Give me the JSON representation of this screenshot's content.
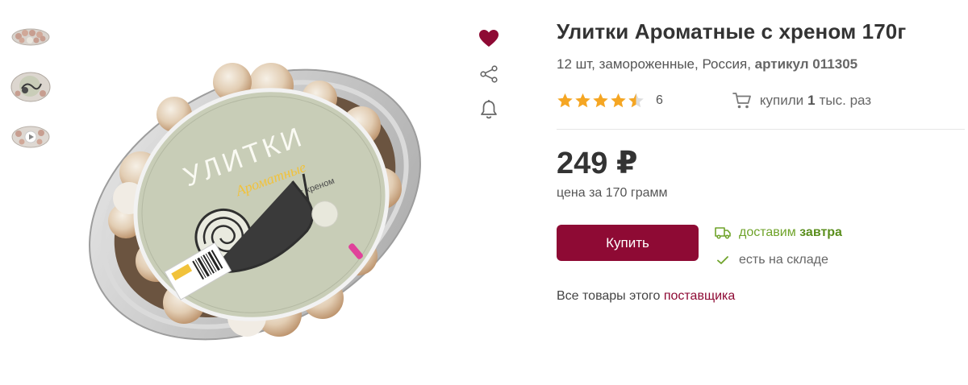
{
  "thumbnails": [
    {
      "name": "thumbnail-1",
      "icon": "product-thumbnail"
    },
    {
      "name": "thumbnail-2",
      "icon": "product-thumbnail"
    },
    {
      "name": "thumbnail-3",
      "icon": "video-thumbnail"
    }
  ],
  "product_image": {
    "lid_title": "УЛИТКИ",
    "lid_brand": "Ароматные",
    "lid_flavor": "с хреном",
    "icon": "snail-illustration"
  },
  "actions": {
    "favorite_icon": "heart-icon",
    "share_icon": "share-icon",
    "notify_icon": "bell-icon",
    "favorite_color": "#8e0a34"
  },
  "product": {
    "title": "Улитки Ароматные с хреном 170г",
    "subtitle_main": "12 шт, замороженные, Россия,",
    "article_label": "артикул 011305"
  },
  "rating": {
    "stars": 4.5,
    "count": "6",
    "star_color": "#f5a623"
  },
  "bought": {
    "prefix": "купили",
    "amount": "1",
    "suffix": "тыс. раз",
    "icon": "cart-icon"
  },
  "price": {
    "value": "249 ₽",
    "per_unit": "цена за 170 грамм"
  },
  "buy": {
    "label": "Купить",
    "color": "#8e0a34"
  },
  "delivery": {
    "prefix": "доставим",
    "when": "завтра",
    "stock": "есть на складе",
    "color": "#6fa32a",
    "truck_icon": "truck-icon",
    "check_icon": "check-icon"
  },
  "supplier": {
    "text": "Все товары этого",
    "link": "поставщика"
  }
}
